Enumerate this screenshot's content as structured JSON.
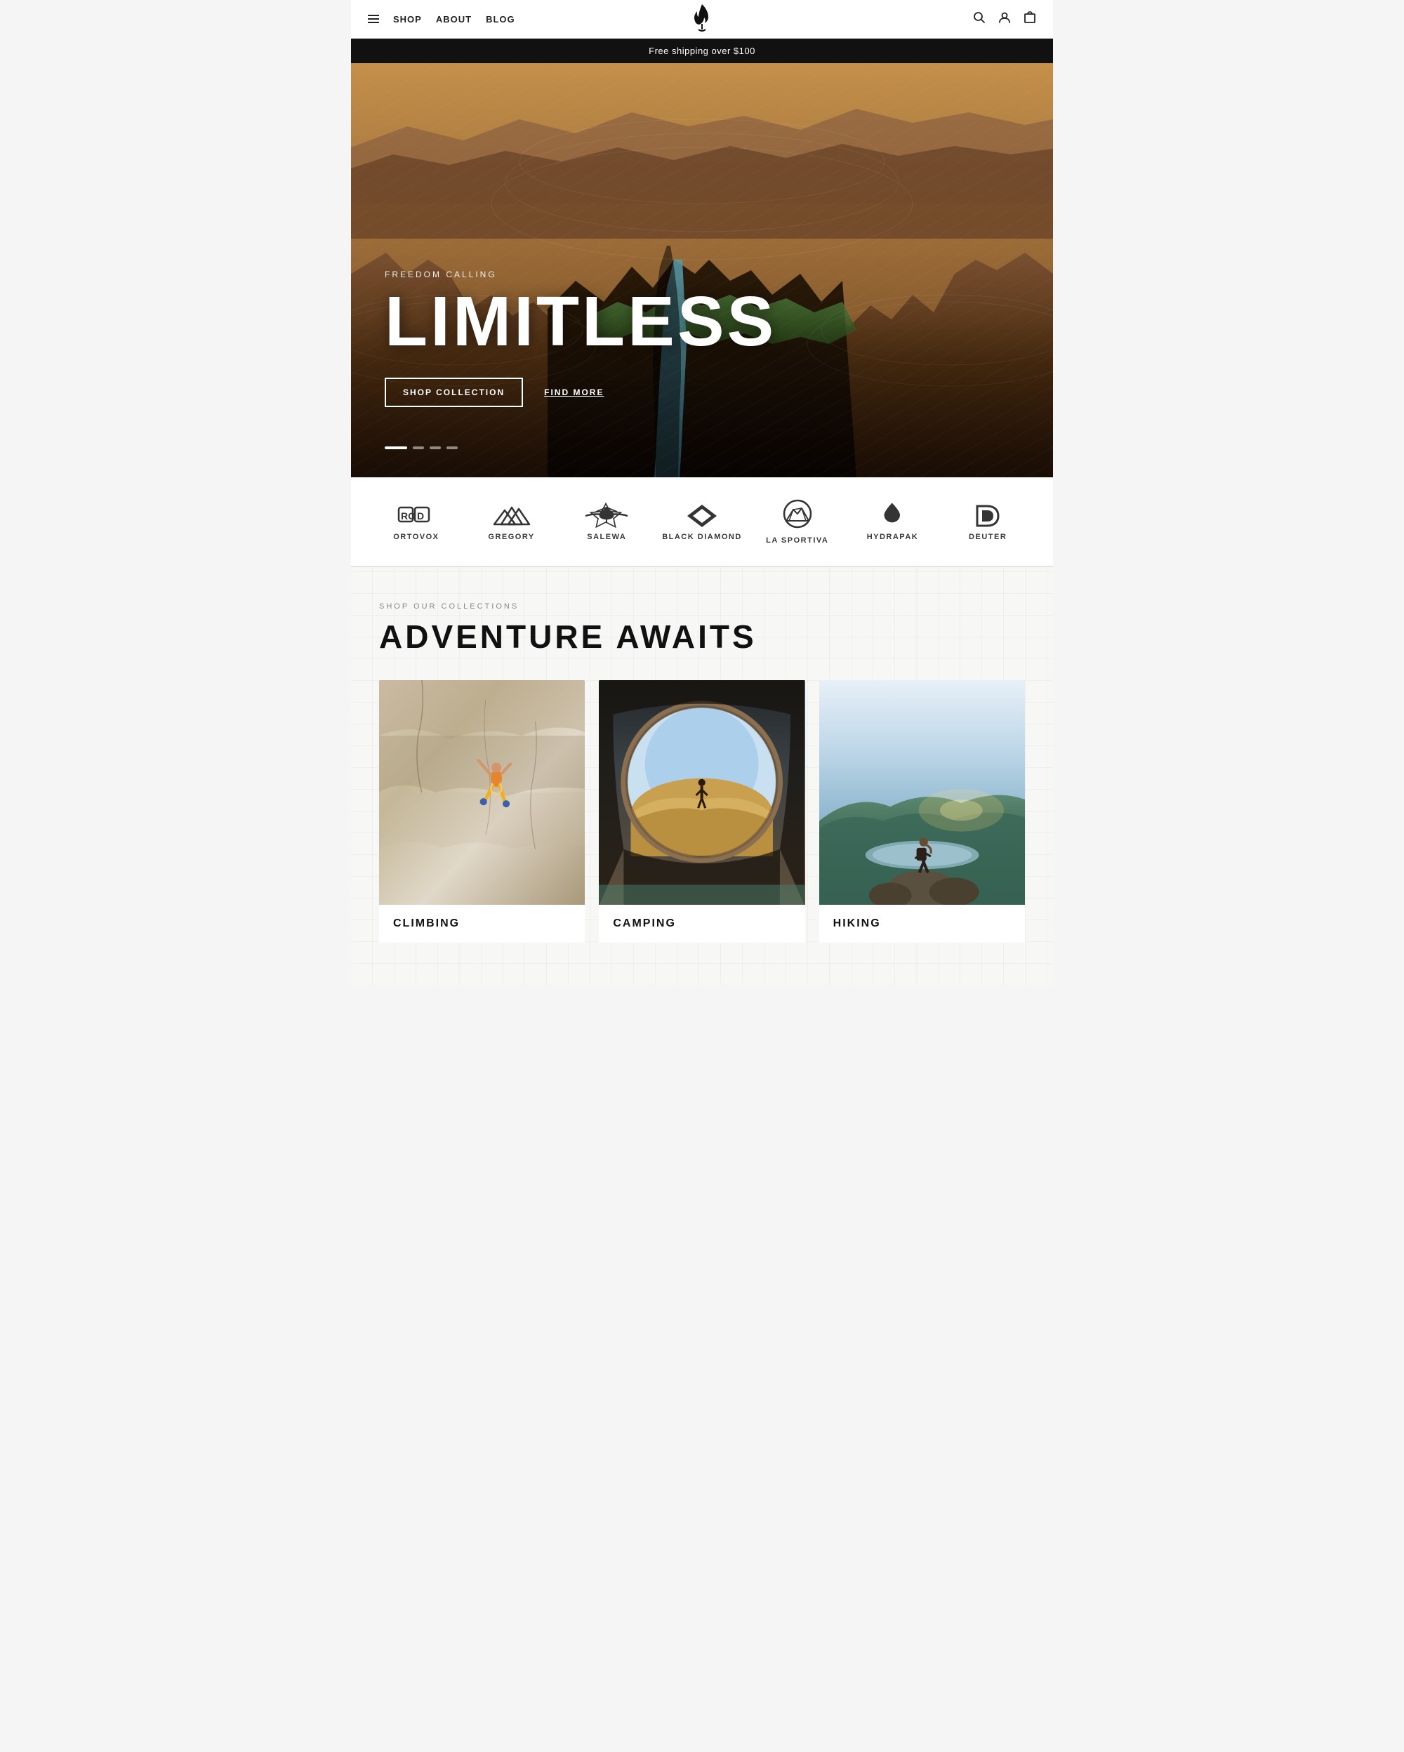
{
  "nav": {
    "menu_label": "SHOP",
    "about_label": "ABOUT",
    "blog_label": "BLOG",
    "logo_symbol": "🔥",
    "search_label": "search",
    "account_label": "account",
    "cart_label": "cart"
  },
  "announcement": {
    "text": "Free shipping over $100"
  },
  "hero": {
    "subtitle": "FREEDOM CALLING",
    "title": "LIMITLESS",
    "btn_shop": "SHOP COLLECTION",
    "btn_find": "FIND MORE",
    "dots": [
      {
        "active": true
      },
      {
        "active": false
      },
      {
        "active": false
      },
      {
        "active": false
      }
    ]
  },
  "brands": [
    {
      "name": "ORTOVOX",
      "id": "ortovox"
    },
    {
      "name": "GREGORY",
      "id": "gregory"
    },
    {
      "name": "SALEWA",
      "id": "salewa"
    },
    {
      "name": "Black Diamond",
      "id": "blackdiamond"
    },
    {
      "name": "LA SPORTIVA",
      "id": "lasportiva"
    },
    {
      "name": "HydraPak",
      "id": "hydrapak"
    },
    {
      "name": "deuter",
      "id": "deuter"
    }
  ],
  "collections": {
    "label": "SHOP OUR COLLECTIONS",
    "title": "ADVENTURE AWAITS",
    "items": [
      {
        "id": "climbing",
        "label": "CLIMBING"
      },
      {
        "id": "camping",
        "label": "CAMPING"
      },
      {
        "id": "hiking",
        "label": "HIKING"
      }
    ]
  }
}
